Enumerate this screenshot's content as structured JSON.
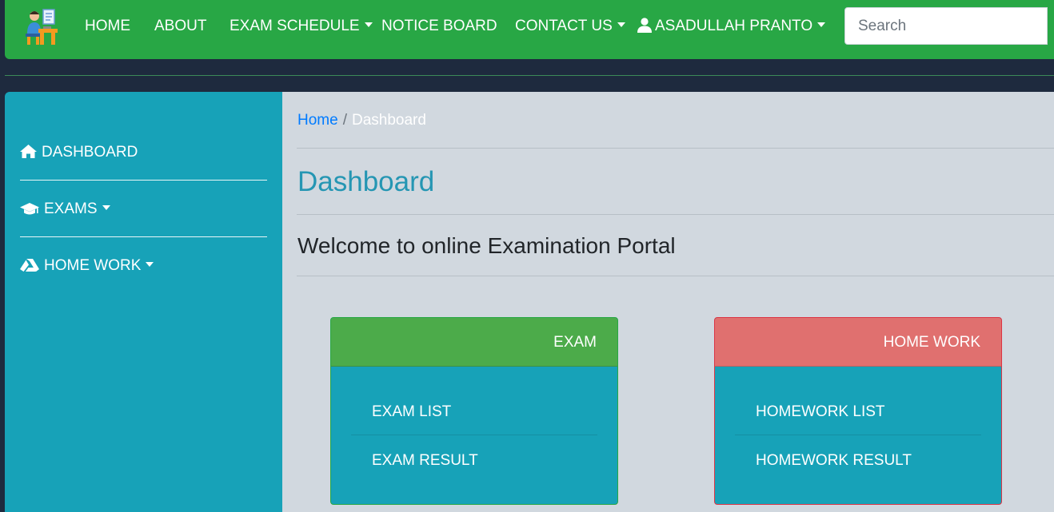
{
  "navbar": {
    "items": [
      {
        "label": "HOME"
      },
      {
        "label": "ABOUT"
      },
      {
        "label": "EXAM SCHEDULE"
      },
      {
        "label": "NOTICE BOARD"
      },
      {
        "label": "CONTACT US"
      }
    ],
    "user_name": "ASADULLAH PRANTO",
    "search_placeholder": "Search",
    "color": "#28a745"
  },
  "sidebar": {
    "items": [
      {
        "label": "DASHBOARD",
        "icon": "home-icon"
      },
      {
        "label": "EXAMS",
        "icon": "graduation-cap-icon"
      },
      {
        "label": "HOME WORK",
        "icon": "drive-icon"
      }
    ],
    "color": "#17a2b8"
  },
  "main": {
    "breadcrumb": {
      "home": "Home",
      "separator": "/",
      "current": "Dashboard"
    },
    "title": "Dashboard",
    "welcome": "Welcome to online Examination Portal",
    "cards": [
      {
        "title": "EXAM",
        "links": [
          "EXAM LIST",
          "EXAM RESULT"
        ],
        "header_color": "#4cab4a"
      },
      {
        "title": "HOME WORK",
        "links": [
          "HOMEWORK LIST",
          "HOMEWORK RESULT"
        ],
        "header_color": "#e0706f"
      }
    ]
  }
}
